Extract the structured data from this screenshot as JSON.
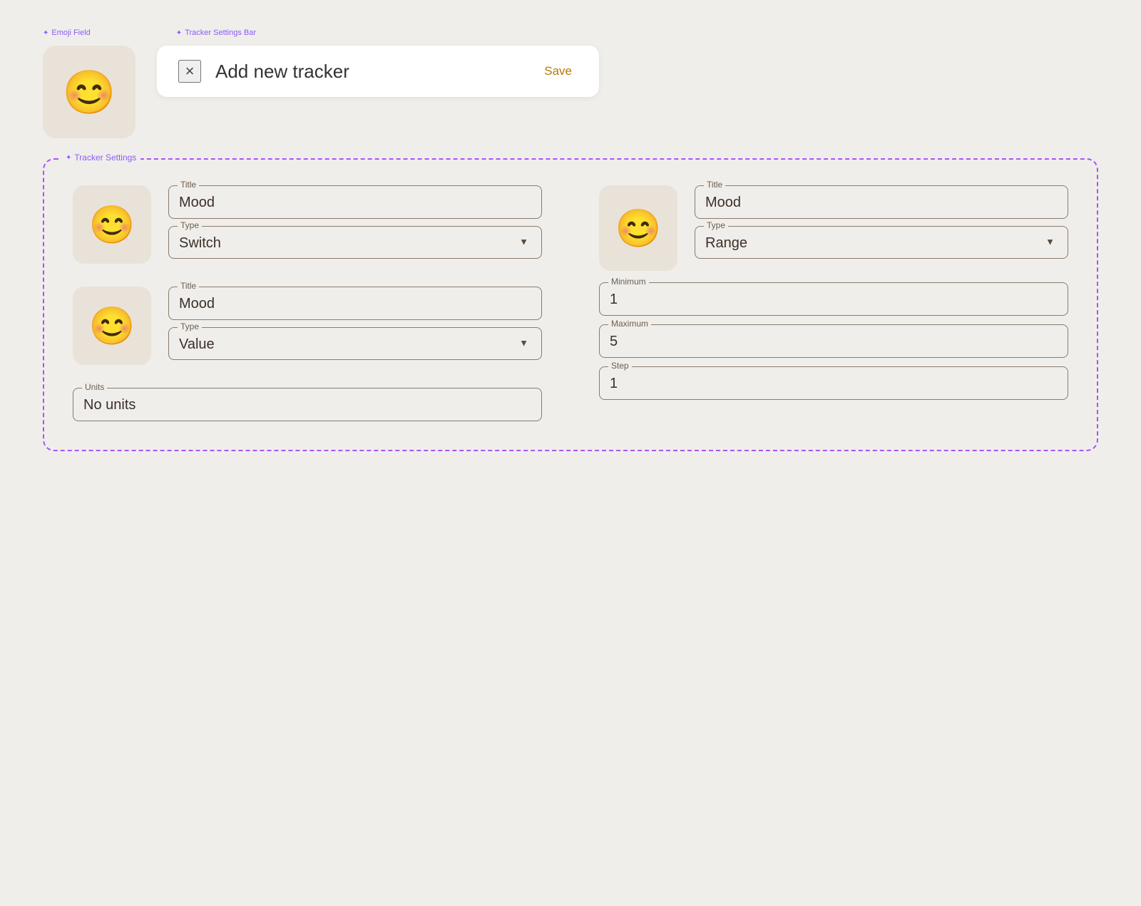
{
  "annotations": {
    "emoji_field_label": "Emoji Field",
    "tracker_settings_bar_label": "Tracker Settings Bar",
    "tracker_settings_label": "Tracker Settings"
  },
  "header": {
    "close_icon": "×",
    "title": "Add new tracker",
    "save_label": "Save"
  },
  "top_emoji": "😊",
  "left_column": {
    "card1": {
      "emoji": "😊",
      "title_label": "Title",
      "title_value": "Mood",
      "type_label": "Type",
      "type_value": "Switch",
      "type_options": [
        "Switch",
        "Range",
        "Value"
      ]
    },
    "card2": {
      "emoji": "😊",
      "title_label": "Title",
      "title_value": "Mood",
      "type_label": "Type",
      "type_value": "Value",
      "type_options": [
        "Switch",
        "Range",
        "Value"
      ]
    },
    "units": {
      "label": "Units",
      "value": "No units"
    }
  },
  "right_column": {
    "card": {
      "emoji": "😊",
      "title_label": "Title",
      "title_value": "Mood",
      "type_label": "Type",
      "type_value": "Range",
      "type_options": [
        "Switch",
        "Range",
        "Value"
      ]
    },
    "minimum": {
      "label": "Minimum",
      "value": "1"
    },
    "maximum": {
      "label": "Maximum",
      "value": "5"
    },
    "step": {
      "label": "Step",
      "value": "1"
    }
  }
}
